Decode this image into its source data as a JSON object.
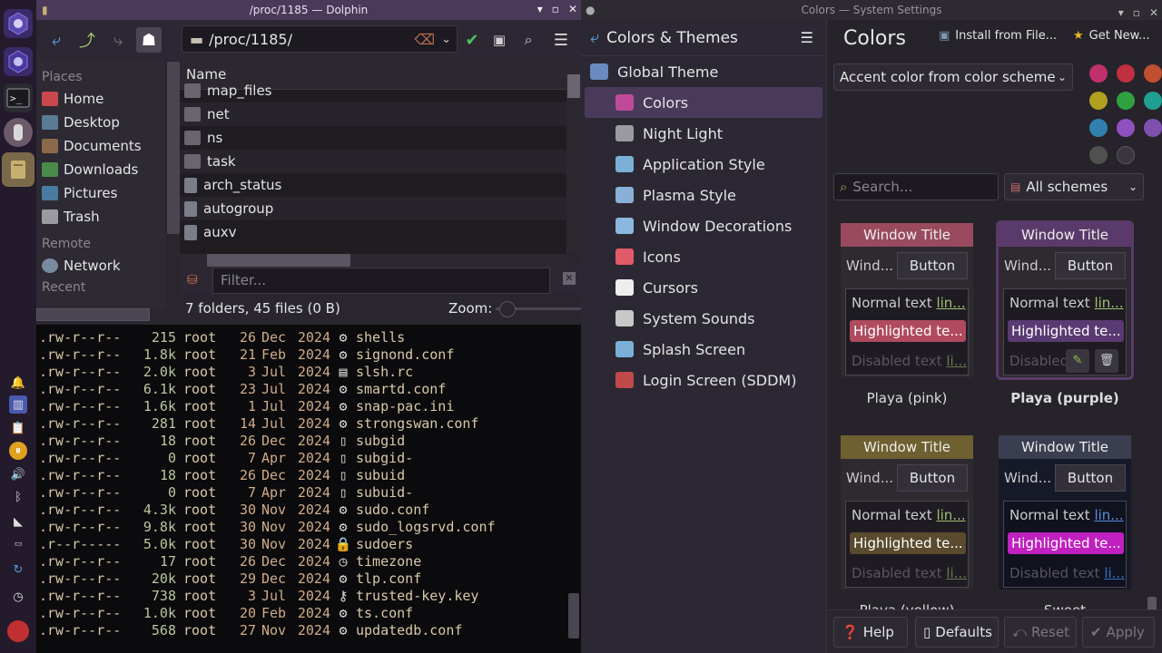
{
  "dolphin": {
    "title": "/proc/1185 — Dolphin",
    "path": "/proc/1185/",
    "places_header": "Places",
    "places": [
      {
        "label": "Home",
        "icon": "home-icon",
        "color": "#c9484e"
      },
      {
        "label": "Desktop",
        "icon": "desktop-folder-icon",
        "color": "#5a7a96"
      },
      {
        "label": "Documents",
        "icon": "documents-folder-icon",
        "color": "#8a6a4a"
      },
      {
        "label": "Downloads",
        "icon": "downloads-folder-icon",
        "color": "#4a8a4a"
      },
      {
        "label": "Pictures",
        "icon": "pictures-folder-icon",
        "color": "#4a7aa0"
      },
      {
        "label": "Trash",
        "icon": "trash-icon",
        "color": "#9a9aa0"
      }
    ],
    "remote_header": "Remote",
    "network_label": "Network",
    "recent_header": "Recent",
    "column_name": "Name",
    "files": [
      {
        "name": "map_files",
        "kind": "folder-locked"
      },
      {
        "name": "net",
        "kind": "folder"
      },
      {
        "name": "ns",
        "kind": "folder-locked"
      },
      {
        "name": "task",
        "kind": "folder"
      },
      {
        "name": "arch_status",
        "kind": "file"
      },
      {
        "name": "autogroup",
        "kind": "file"
      },
      {
        "name": "auxv",
        "kind": "file-locked"
      }
    ],
    "filter_placeholder": "Filter...",
    "status": "7 folders, 45 files (0 B)",
    "zoom_label": "Zoom:"
  },
  "terminal": {
    "rows": [
      {
        "perm": ".rw-r--r--",
        "size": "215",
        "owner": "root",
        "day": "26",
        "mon": "Dec",
        "year": "2024",
        "sym": "⚙",
        "name": "shells"
      },
      {
        "perm": ".rw-r--r--",
        "size": "1.8k",
        "owner": "root",
        "day": "21",
        "mon": "Feb",
        "year": "2024",
        "sym": "⚙",
        "name": "signond.conf"
      },
      {
        "perm": ".rw-r--r--",
        "size": "2.0k",
        "owner": "root",
        "day": "3",
        "mon": "Jul",
        "year": "2024",
        "sym": "▤",
        "name": "slsh.rc"
      },
      {
        "perm": ".rw-r--r--",
        "size": "6.1k",
        "owner": "root",
        "day": "23",
        "mon": "Jul",
        "year": "2024",
        "sym": "⚙",
        "name": "smartd.conf"
      },
      {
        "perm": ".rw-r--r--",
        "size": "1.6k",
        "owner": "root",
        "day": "1",
        "mon": "Jul",
        "year": "2024",
        "sym": "⚙",
        "name": "snap-pac.ini"
      },
      {
        "perm": ".rw-r--r--",
        "size": "281",
        "owner": "root",
        "day": "14",
        "mon": "Jul",
        "year": "2024",
        "sym": "⚙",
        "name": "strongswan.conf"
      },
      {
        "perm": ".rw-r--r--",
        "size": "18",
        "owner": "root",
        "day": "26",
        "mon": "Dec",
        "year": "2024",
        "sym": "▯",
        "name": "subgid"
      },
      {
        "perm": ".rw-r--r--",
        "size": "0",
        "owner": "root",
        "day": "7",
        "mon": "Apr",
        "year": "2024",
        "sym": "▯",
        "name": "subgid-"
      },
      {
        "perm": ".rw-r--r--",
        "size": "18",
        "owner": "root",
        "day": "26",
        "mon": "Dec",
        "year": "2024",
        "sym": "▯",
        "name": "subuid"
      },
      {
        "perm": ".rw-r--r--",
        "size": "0",
        "owner": "root",
        "day": "7",
        "mon": "Apr",
        "year": "2024",
        "sym": "▯",
        "name": "subuid-"
      },
      {
        "perm": ".rw-r--r--",
        "size": "4.3k",
        "owner": "root",
        "day": "30",
        "mon": "Nov",
        "year": "2024",
        "sym": "⚙",
        "name": "sudo.conf"
      },
      {
        "perm": ".rw-r--r--",
        "size": "9.8k",
        "owner": "root",
        "day": "30",
        "mon": "Nov",
        "year": "2024",
        "sym": "⚙",
        "name": "sudo_logsrvd.conf"
      },
      {
        "perm": ".r--r-----",
        "size": "5.0k",
        "owner": "root",
        "day": "30",
        "mon": "Nov",
        "year": "2024",
        "sym": "🔒",
        "name": "sudoers"
      },
      {
        "perm": ".rw-r--r--",
        "size": "17",
        "owner": "root",
        "day": "26",
        "mon": "Dec",
        "year": "2024",
        "sym": "◷",
        "name": "timezone"
      },
      {
        "perm": ".rw-r--r--",
        "size": "20k",
        "owner": "root",
        "day": "29",
        "mon": "Dec",
        "year": "2024",
        "sym": "⚙",
        "name": "tlp.conf"
      },
      {
        "perm": ".rw-r--r--",
        "size": "738",
        "owner": "root",
        "day": "3",
        "mon": "Jul",
        "year": "2024",
        "sym": "⚷",
        "name": "trusted-key.key"
      },
      {
        "perm": ".rw-r--r--",
        "size": "1.0k",
        "owner": "root",
        "day": "20",
        "mon": "Feb",
        "year": "2024",
        "sym": "⚙",
        "name": "ts.conf"
      },
      {
        "perm": ".rw-r--r--",
        "size": "568",
        "owner": "root",
        "day": "27",
        "mon": "Nov",
        "year": "2024",
        "sym": "⚙",
        "name": "updatedb.conf"
      }
    ]
  },
  "settings": {
    "title": "Colors — System Settings",
    "section": "Colors & Themes",
    "nav": [
      {
        "label": "Global Theme",
        "icon": "global-theme-icon",
        "color": "#6a8ac0",
        "indent": false,
        "selected": false
      },
      {
        "label": "Colors",
        "icon": "colors-icon",
        "color": "#c04a9a",
        "indent": true,
        "selected": true
      },
      {
        "label": "Night Light",
        "icon": "night-light-icon",
        "color": "#9a9aa0",
        "indent": true,
        "selected": false
      },
      {
        "label": "Application Style",
        "icon": "application-style-icon",
        "color": "#7ab0d8",
        "indent": true,
        "selected": false
      },
      {
        "label": "Plasma Style",
        "icon": "plasma-style-icon",
        "color": "#8ab0d8",
        "indent": true,
        "selected": false
      },
      {
        "label": "Window Decorations",
        "icon": "window-decorations-icon",
        "color": "#8ab8e0",
        "indent": true,
        "selected": false
      },
      {
        "label": "Icons",
        "icon": "icons-icon",
        "color": "#e05a6a",
        "indent": true,
        "selected": false
      },
      {
        "label": "Cursors",
        "icon": "cursors-icon",
        "color": "#eeeeee",
        "indent": true,
        "selected": false
      },
      {
        "label": "System Sounds",
        "icon": "system-sounds-icon",
        "color": "#c8c8c8",
        "indent": true,
        "selected": false
      },
      {
        "label": "Splash Screen",
        "icon": "splash-screen-icon",
        "color": "#7ab0d8",
        "indent": true,
        "selected": false
      },
      {
        "label": "Login Screen (SDDM)",
        "icon": "login-screen-icon",
        "color": "#c04a4a",
        "indent": true,
        "selected": false
      }
    ],
    "page_title": "Colors",
    "install_label": "Install from File...",
    "get_new_label": "Get New...",
    "accent_combo": "Accent color from color scheme",
    "search_placeholder": "Search...",
    "schemes_combo": "All schemes",
    "accent_swatches": [
      "#c0306a",
      "#c03040",
      "#c05030",
      "#b0a020",
      "#30a040",
      "#20a090",
      "#3080b0",
      "#9050c0",
      "#8050b0",
      "#505050"
    ],
    "schemes": [
      {
        "name": "Playa (pink)",
        "title": "Window Title",
        "wind": "Wind...",
        "button": "Button",
        "normal": "Normal text",
        "link": "lin...",
        "highlighted": "Highlighted te...",
        "disabled": "Disabled text",
        "dlink": "li...",
        "title_bg": "#9a4a5e",
        "hl_bg": "#b04a5e",
        "bg": "#2e2a30",
        "link_color": "#a0c070"
      },
      {
        "name": "Playa (purple)",
        "title": "Window Title",
        "wind": "Wind...",
        "button": "Button",
        "normal": "Normal text",
        "link": "lin...",
        "highlighted": "Highlighted te...",
        "disabled": "Disabled",
        "dlink": "",
        "title_bg": "#5a3a6a",
        "hl_bg": "#5a3a72",
        "bg": "#2e2a30",
        "link_color": "#a0c070"
      },
      {
        "name": "Playa (yellow)",
        "title": "Window Title",
        "wind": "Wind...",
        "button": "Button",
        "normal": "Normal text",
        "link": "lin...",
        "highlighted": "Highlighted te...",
        "disabled": "Disabled text",
        "dlink": "li...",
        "title_bg": "#6e6030",
        "hl_bg": "#5a4a2e",
        "bg": "#2e2a30",
        "link_color": "#a0c070"
      },
      {
        "name": "Sweet",
        "title": "Window Title",
        "wind": "Wind...",
        "button": "Button",
        "normal": "Normal text",
        "link": "lin...",
        "highlighted": "Highlighted te...",
        "disabled": "Disabled text",
        "dlink": "li...",
        "title_bg": "#3a3e50",
        "hl_bg": "#c020c0",
        "bg": "#161928",
        "link_color": "#5a90e0"
      }
    ],
    "buttons": {
      "help": "Help",
      "defaults": "Defaults",
      "reset": "Reset",
      "apply": "Apply"
    }
  }
}
